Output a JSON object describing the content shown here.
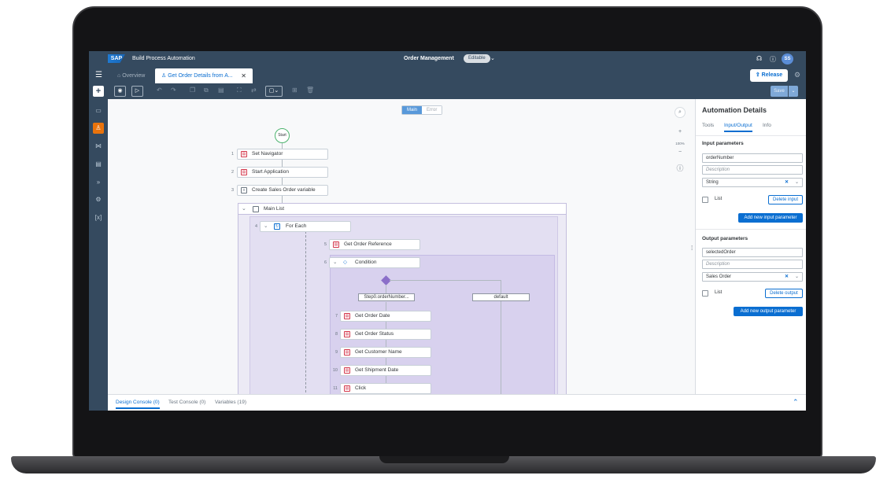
{
  "shell": {
    "logo": "SAP",
    "product": "Build Process Automation",
    "project": "Order Management",
    "status": "Editable",
    "avatar": "SS",
    "icons": [
      "announcement-icon",
      "help-icon"
    ]
  },
  "tabs": {
    "overview": "Overview",
    "active": "Get Order Details from A...",
    "release": "Release"
  },
  "toolbar": {
    "save": "Save"
  },
  "canvas": {
    "segment": {
      "main": "Main",
      "error": "Error"
    },
    "start": "Start",
    "steps": [
      {
        "num": "1",
        "label": "Set Navigator"
      },
      {
        "num": "2",
        "label": "Start Application"
      },
      {
        "num": "3",
        "label": "Create Sales Order variable"
      }
    ],
    "group": {
      "label": "Main List"
    },
    "foreach": {
      "num": "4",
      "label": "For Each"
    },
    "reference": {
      "num": "5",
      "label": "Get Order Reference"
    },
    "condition": {
      "num": "6",
      "label": "Condition"
    },
    "branches": {
      "left": "Step0.orderNumber...",
      "right": "default"
    },
    "inner_steps": [
      {
        "num": "7",
        "label": "Get Order Date"
      },
      {
        "num": "8",
        "label": "Get Order Status"
      },
      {
        "num": "9",
        "label": "Get Customer Name"
      },
      {
        "num": "10",
        "label": "Get Shipment Date"
      },
      {
        "num": "11",
        "label": "Click"
      }
    ],
    "zoom_level": "100%"
  },
  "panel": {
    "title": "Automation Details",
    "tabs": [
      "Tools",
      "Input/Output",
      "Info"
    ],
    "input": {
      "heading": "Input parameters",
      "name": "orderNumber",
      "description_placeholder": "Description",
      "type": "String",
      "list_label": "List",
      "delete": "Delete input",
      "add": "Add new input parameter"
    },
    "output": {
      "heading": "Output parameters",
      "name": "selectedOrder",
      "description_placeholder": "Description",
      "type": "Sales Order",
      "list_label": "List",
      "delete": "Delete output",
      "add": "Add new output parameter"
    }
  },
  "bottom": {
    "tabs": [
      "Design Console (0)",
      "Test Console (0)",
      "Variables (19)"
    ]
  },
  "colors": {
    "shell": "#354a5f",
    "accent": "#0a6ed1",
    "active_nav": "#e9730c",
    "group_fill": "#e3dff2"
  }
}
